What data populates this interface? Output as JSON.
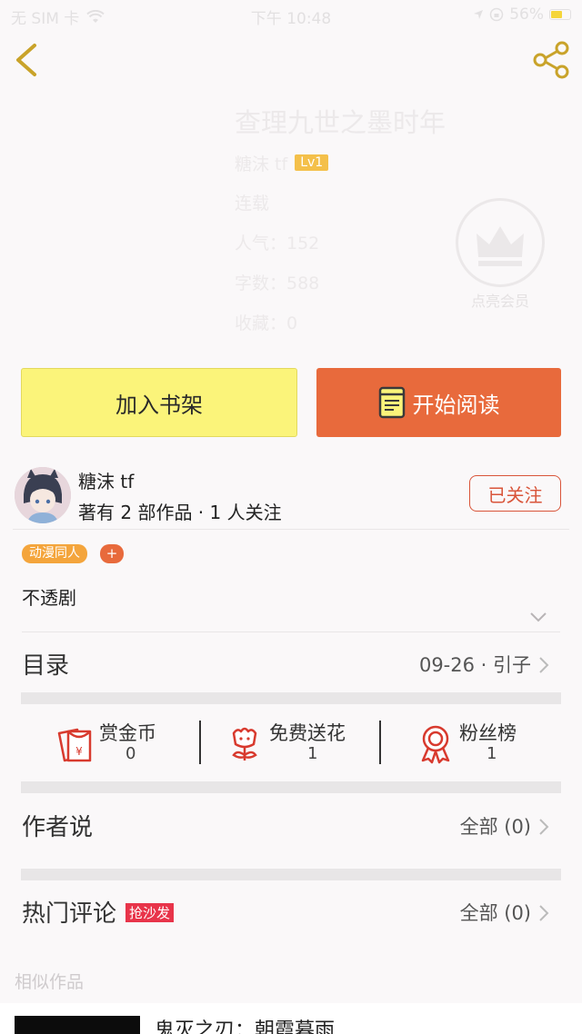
{
  "status_bar": {
    "carrier": "无 SIM 卡",
    "time": "下午 10:48",
    "battery": "56%",
    "battery_level": 0.56
  },
  "book": {
    "title": "查理九世之墨时年",
    "author": "糖沫 tf",
    "level": "Lv1",
    "status": "连载",
    "popularity": "人气：152",
    "word_count": "字数：588",
    "favorites": "收藏：0"
  },
  "vip": {
    "label": "点亮会员"
  },
  "actions": {
    "add_shelf": "加入书架",
    "start_read": "开始阅读"
  },
  "author_card": {
    "name": "糖沫 tf",
    "stats": "著有 2 部作品 · 1 人关注",
    "follow_label": "已关注"
  },
  "tag": {
    "label": "动漫同人",
    "add": "+"
  },
  "synopsis": "不透剧",
  "catalog": {
    "label": "目录",
    "latest": "09-26 · 引子"
  },
  "stats": [
    {
      "label": "赏金币",
      "value": "0",
      "icon": "red-envelope-icon"
    },
    {
      "label": "免费送花",
      "value": "1",
      "icon": "flower-icon"
    },
    {
      "label": "粉丝榜",
      "value": "1",
      "icon": "medal-icon"
    }
  ],
  "author_say": {
    "label": "作者说",
    "value": "全部 (0)"
  },
  "hot_comments": {
    "label": "热门评论",
    "badge": "抢沙发",
    "value": "全部 (0)"
  },
  "similar": {
    "title": "相似作品",
    "first_item": "鬼灭之刃：朝霞暮雨"
  },
  "colors": {
    "accent_orange": "#e86a3c",
    "shelf_yellow": "#fbf47a",
    "tag_orange": "#f4a53c",
    "follow_red": "#d9553a",
    "icon_red": "#d83a2e",
    "hot_red": "#e8344a",
    "nav_gold": "#c9a32a"
  }
}
